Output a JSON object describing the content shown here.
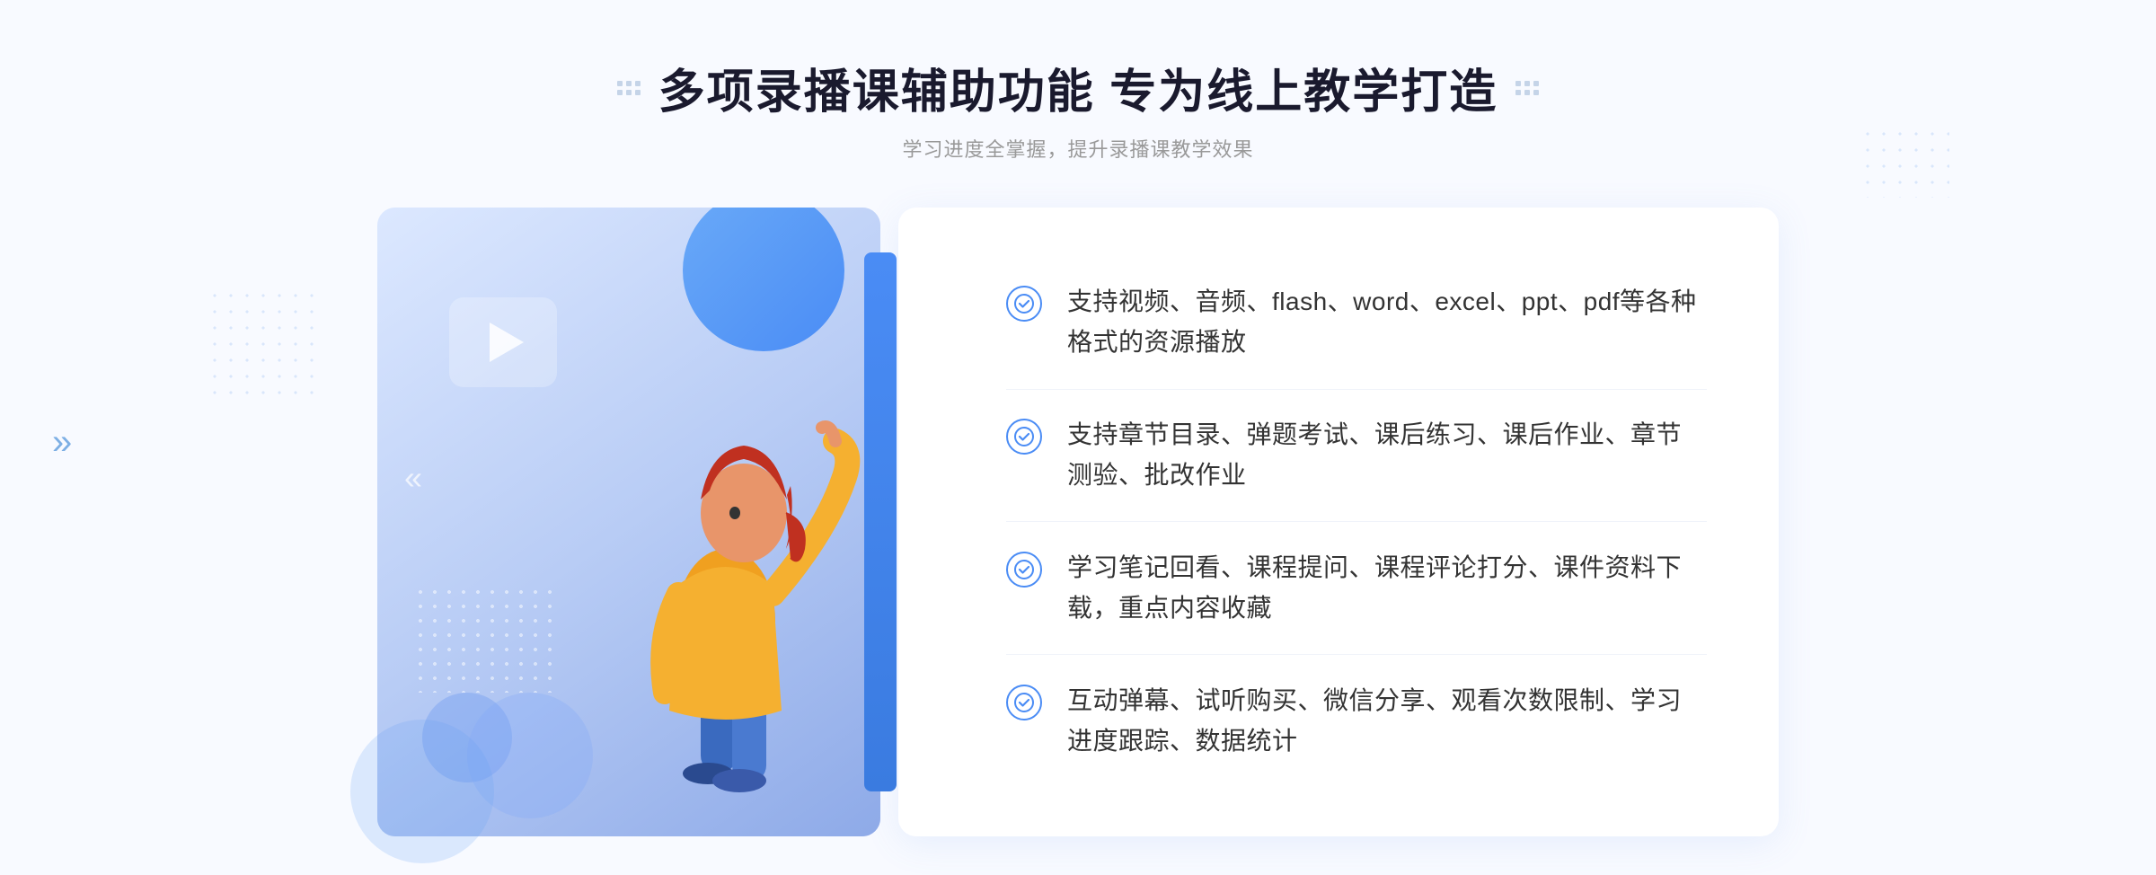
{
  "page": {
    "title": "多项录播课辅助功能 专为线上教学打造",
    "subtitle": "学习进度全掌握，提升录播课教学效果",
    "features": [
      {
        "id": 1,
        "text": "支持视频、音频、flash、word、excel、ppt、pdf等各种格式的资源播放"
      },
      {
        "id": 2,
        "text": "支持章节目录、弹题考试、课后练习、课后作业、章节测验、批改作业"
      },
      {
        "id": 3,
        "text": "学习笔记回看、课程提问、课程评论打分、课件资料下载，重点内容收藏"
      },
      {
        "id": 4,
        "text": "互动弹幕、试听购买、微信分享、观看次数限制、学习进度跟踪、数据统计"
      }
    ],
    "play_button_label": "播放",
    "chevron_symbol": "»",
    "left_chevron_symbol": "»"
  }
}
